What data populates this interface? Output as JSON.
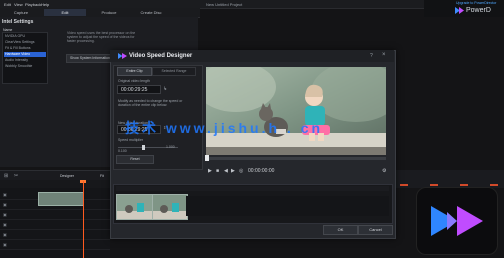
{
  "menubar": {
    "items": [
      "Edit",
      "View",
      "Playback",
      "Help"
    ],
    "title": "New Untitled Project"
  },
  "tabs": [
    {
      "label": "Capture"
    },
    {
      "label": "Edit"
    },
    {
      "label": "Produce"
    },
    {
      "label": "Create Disc"
    }
  ],
  "brand": {
    "top": "Upgrade to PowerDirector",
    "name": "PowerD"
  },
  "left_panel": {
    "title": "Intel Settings",
    "list_header": "Name",
    "list_items": [
      "NVIDIA GPU",
      "ClearView Settings",
      "Fit & Fill Buttons",
      "Hardware Video",
      "Audio Intensity",
      "Wobbly Smoothie"
    ],
    "selected_index": 3,
    "intro": "Video speed uses the best processor on the system to adjust the speed of the videos for faster processing.",
    "system_button": "Show System Information"
  },
  "dialog": {
    "title": "Video Speed Designer",
    "tabs": [
      "Entire Clip",
      "Selected Range"
    ],
    "original_length_label": "Original video length",
    "original_length": "00:00:29:25",
    "desc": "Modify as needed to change the speed or duration of the entire clip below.",
    "new_length_label": "New video duration",
    "new_length": "00:00:29:25",
    "speed_label": "Speed multiplier",
    "speed_min": "0.100",
    "speed_value": "1.000",
    "reset": "Reset",
    "timecode": "00:00:00:00",
    "ok": "OK",
    "cancel": "Cancel"
  },
  "player": {
    "play_icon": "play-icon",
    "stop_icon": "stop-icon",
    "prev_icon": "prev-frame-icon",
    "next_icon": "next-frame-icon",
    "snapshot_icon": "snapshot-icon"
  },
  "timeline": {
    "toolbar_label": "Designer",
    "fit_label": "Fit"
  },
  "watermark": "技术 www.jishu.h . cn"
}
